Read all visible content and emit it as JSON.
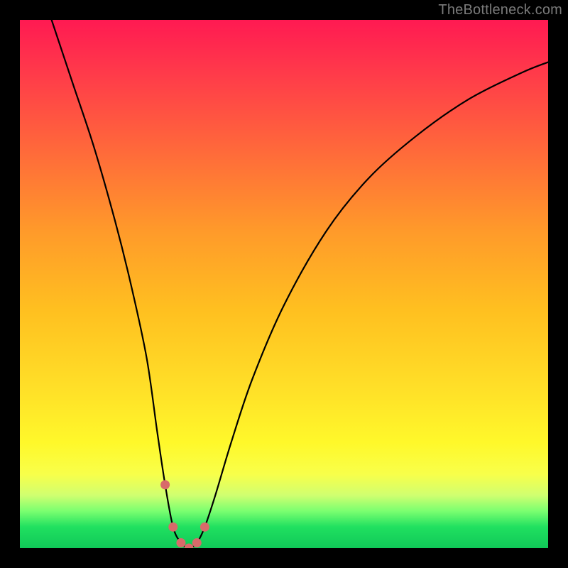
{
  "watermark": "TheBottleneck.com",
  "chart_data": {
    "type": "line",
    "title": "",
    "xlabel": "",
    "ylabel": "",
    "xlim": [
      0,
      100
    ],
    "ylim": [
      0,
      100
    ],
    "series": [
      {
        "name": "bottleneck-curve",
        "x": [
          6,
          10,
          14,
          18,
          21,
          24,
          26,
          27.5,
          29,
          30.5,
          32,
          33.5,
          35,
          37,
          40,
          44,
          50,
          58,
          66,
          75,
          85,
          95,
          100
        ],
        "y": [
          100,
          88,
          76,
          62,
          50,
          36,
          22,
          12,
          4,
          1,
          0,
          1,
          4,
          10,
          20,
          32,
          46,
          60,
          70,
          78,
          85,
          90,
          92
        ]
      }
    ],
    "markers": {
      "name": "highlighted-points",
      "color": "#d86a6a",
      "x": [
        27.5,
        29,
        30.5,
        32,
        33.5,
        35
      ],
      "y": [
        12,
        4,
        1,
        0,
        1,
        4
      ]
    },
    "minimum": {
      "x": 32,
      "y": 0
    },
    "gradient_stops": [
      {
        "pos": 0.0,
        "color": "#ff1a52"
      },
      {
        "pos": 0.5,
        "color": "#ffc020"
      },
      {
        "pos": 0.85,
        "color": "#fff82a"
      },
      {
        "pos": 1.0,
        "color": "#10c858"
      }
    ]
  }
}
